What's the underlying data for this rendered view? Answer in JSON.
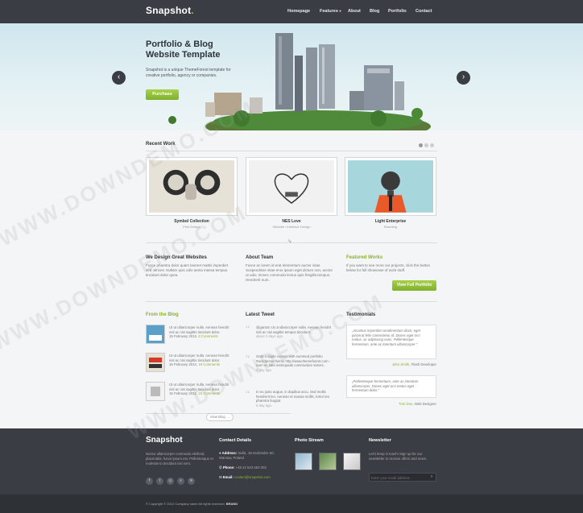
{
  "header": {
    "logo": "Snapshot",
    "nav": [
      "Homepage",
      "Features",
      "About",
      "Blog",
      "Portfolio",
      "Contact"
    ],
    "nav_dropdown_icon": "chevron-down-icon"
  },
  "hero": {
    "title": "Portfolio & Blog Website Template",
    "text": "Snapshot is a unique ThemeForest template for creative portfolio, agency or companies.",
    "button": "Purchase",
    "prev_icon": "chevron-left-icon",
    "next_icon": "chevron-right-icon"
  },
  "recent_work": {
    "heading": "Recent Work",
    "items": [
      {
        "title": "Symbol Collection",
        "sub": "Print Design"
      },
      {
        "title": "NES Love",
        "sub": "Website / Interface Design"
      },
      {
        "title": "Light Enterprise",
        "sub": "Branding"
      }
    ]
  },
  "features": [
    {
      "heading": "We Design Great Websites",
      "text": "Fusce pharetra dolor quam laoreet mattis imperdiet sed ultrices. Nullam quis odio aenia massa tempus tincidunt dolor quea."
    },
    {
      "heading": "About Team",
      "text": "Fusce ac lorem id erat elementum auctor vitae Suspendisse vitae eros ipsum eget dictum non, auctor ut odio. Donec commodo lectus quis fringilla tempus. Hendrerit eum."
    },
    {
      "heading": "Featured Works",
      "text": "If you want to see more our projects, click the button below for full showcase of work stuff.",
      "button": "View Full Portfolio"
    }
  ],
  "blog": {
    "heading": "From the Blog",
    "items": [
      {
        "text": "Ut ut ullamcorper nulla. Aenean hendrit nisl ac nisi sagittis tincidunt dolor.",
        "meta": "15 February 2012, ",
        "comments": "8 Comments"
      },
      {
        "text": "Ut ut ullamcorper nulla. Aenean hendrit nisl ac nisi sagittis tincidunt dolor.",
        "meta": "15 February 2012, ",
        "comments": "19 Comments"
      },
      {
        "text": "Ut ut ullamcorper nulla. Aenean hendrit nisl ac nisi sagittis tincidunt dolor.",
        "meta": "15 February 2012, ",
        "comments": "23 Comments"
      }
    ],
    "more": "View Blog →"
  },
  "tweets": {
    "heading": "Latest Tweet",
    "items": [
      {
        "text": "@ganton Ut ut ullamcorper nulla. Aenean hendrit nisl ac nisi sagittis tempus tincidunt.",
        "time": "about 4 days ago"
      },
      {
        "text": "Grab a tipple custom with summed portfolio #wordpress theme http://www.themeforest.com - earn on fake insbrquads commodore sisters.",
        "time": "2 day ago"
      },
      {
        "text": "In eu justo augue, in dapibus arcu. Sed mollis hendrerit leo. Aenean et massa mollis, tortor leo pharetra feugiat.",
        "time": "6 day ago"
      }
    ]
  },
  "testimonials": {
    "heading": "Testimonials",
    "items": [
      {
        "text": "„Vivamus imperdiet condimentum diam, eget placerat felis consectetur id. Donec eget orci metus, ac adipiscing nunc. Pellentesque fermentum, ante ac interdum ullamcorper.\"",
        "name": "John Smith",
        "role": ", Flash Developer"
      },
      {
        "text": "„Pellentesque fermentum, ante ac interdum ullamcorper, Donec eget orci metus eget fermentum dolor.\"",
        "name": "Tom Doe",
        "role": ", Web Designer"
      }
    ]
  },
  "footer": {
    "logo": "Snapshot",
    "about": "Nunce ullamcorper commodo eleifend, placerattis, fusce ipsum est. Pellentesque et molestie to tincidunt nisi sem.",
    "contact_heading": "Contact Details",
    "address_label": "Address:",
    "address_value": "Nulla, Jerozolimskie 50, Warsaw, Poland",
    "phone_label": "Phone:",
    "phone_value": "+48 22 543 653 002",
    "email_label": "Email:",
    "email_value": "contact@snapshot.com",
    "photo_heading": "Photo Stream",
    "newsletter_heading": "Newsletter",
    "newsletter_text": "Let's keep in touch! Sign up for our newsletter to recieve offers and news.",
    "newsletter_placeholder": "Enter your email address",
    "copyright": "© Copyright © 2012 Company name All rights reserved. ",
    "copyright_link": "BRAND"
  },
  "watermark": "WWW.DOWNDEMO.COM",
  "colors": {
    "accent": "#8ab32e",
    "dark": "#3a3d44"
  }
}
